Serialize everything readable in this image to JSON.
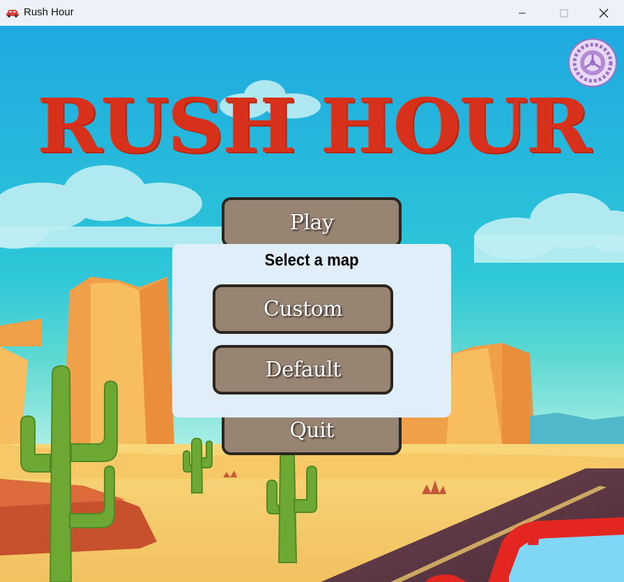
{
  "window": {
    "title": "Rush Hour",
    "icon": "red-car-icon",
    "controls": [
      "minimize-icon",
      "maximize-icon",
      "close-icon"
    ]
  },
  "game": {
    "title": "RUSH HOUR",
    "title_color": "#d8311b",
    "settings_icon": "gear-icon",
    "menu": {
      "play_label": "Play",
      "quit_label": "Quit"
    },
    "map_dialog": {
      "title": "Select a map",
      "custom_label": "Custom",
      "default_label": "Default"
    },
    "colors": {
      "button_fill": "#988473",
      "button_border": "#2b2520",
      "dialog_bg": "#dfeef8",
      "sky": "#22b8e4"
    }
  }
}
